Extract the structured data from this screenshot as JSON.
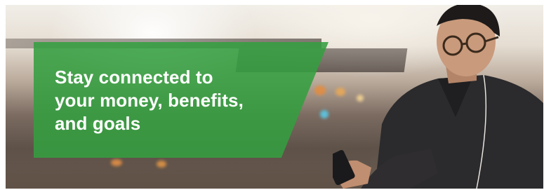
{
  "banner": {
    "headline_lines": [
      "Stay connected to",
      "your money, benefits,",
      "and goals"
    ],
    "panel_color": "#349e40",
    "text_color": "#ffffff"
  },
  "photo": {
    "subject": "man-with-glasses-using-phone"
  }
}
